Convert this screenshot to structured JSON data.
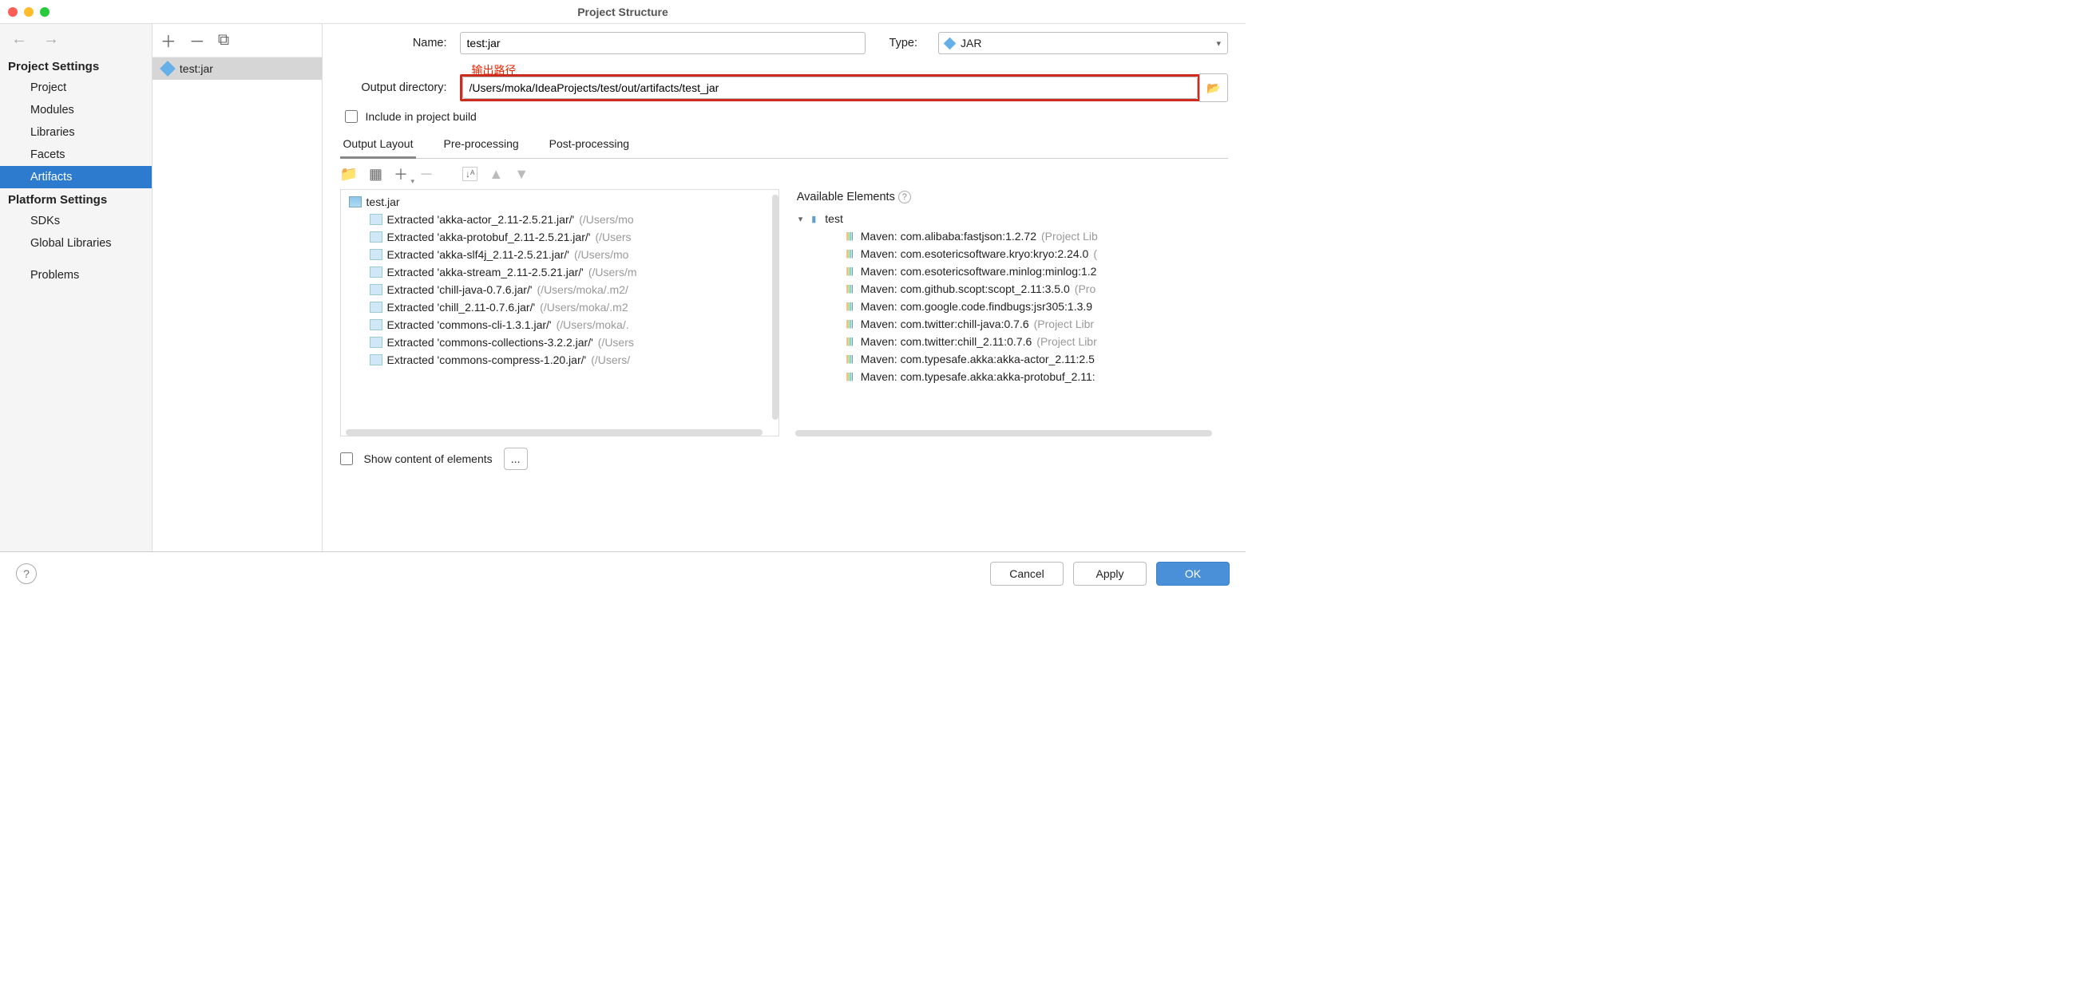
{
  "window": {
    "title": "Project Structure"
  },
  "sidebar": {
    "sections": [
      {
        "title": "Project Settings",
        "items": [
          "Project",
          "Modules",
          "Libraries",
          "Facets",
          "Artifacts"
        ]
      },
      {
        "title": "Platform Settings",
        "items": [
          "SDKs",
          "Global Libraries"
        ]
      }
    ],
    "standalone": [
      "Problems"
    ],
    "active": "Artifacts"
  },
  "listpane": {
    "item": "test:jar"
  },
  "form": {
    "name_label": "Name:",
    "name_value": "test:jar",
    "type_label": "Type:",
    "type_value": "JAR",
    "annotation": "输出路径",
    "outdir_label": "Output directory:",
    "outdir_value": "/Users/moka/IdeaProjects/test/out/artifacts/test_jar",
    "include_label": "Include in project build"
  },
  "tabs": [
    "Output Layout",
    "Pre-processing",
    "Post-processing"
  ],
  "active_tab": "Output Layout",
  "output_tree": {
    "root": "test.jar",
    "children": [
      {
        "label": "Extracted 'akka-actor_2.11-2.5.21.jar/'",
        "suffix": "(/Users/mo"
      },
      {
        "label": "Extracted 'akka-protobuf_2.11-2.5.21.jar/'",
        "suffix": "(/Users"
      },
      {
        "label": "Extracted 'akka-slf4j_2.11-2.5.21.jar/'",
        "suffix": "(/Users/mo"
      },
      {
        "label": "Extracted 'akka-stream_2.11-2.5.21.jar/'",
        "suffix": "(/Users/m"
      },
      {
        "label": "Extracted 'chill-java-0.7.6.jar/'",
        "suffix": "(/Users/moka/.m2/"
      },
      {
        "label": "Extracted 'chill_2.11-0.7.6.jar/'",
        "suffix": "(/Users/moka/.m2"
      },
      {
        "label": "Extracted 'commons-cli-1.3.1.jar/'",
        "suffix": "(/Users/moka/."
      },
      {
        "label": "Extracted 'commons-collections-3.2.2.jar/'",
        "suffix": "(/Users"
      },
      {
        "label": "Extracted 'commons-compress-1.20.jar/'",
        "suffix": "(/Users/"
      }
    ]
  },
  "available": {
    "heading": "Available Elements",
    "root": "test",
    "children": [
      {
        "label": "Maven: com.alibaba:fastjson:1.2.72",
        "suffix": "(Project Lib"
      },
      {
        "label": "Maven: com.esotericsoftware.kryo:kryo:2.24.0",
        "suffix": "("
      },
      {
        "label": "Maven: com.esotericsoftware.minlog:minlog:1.2",
        "suffix": ""
      },
      {
        "label": "Maven: com.github.scopt:scopt_2.11:3.5.0",
        "suffix": "(Pro"
      },
      {
        "label": "Maven: com.google.code.findbugs:jsr305:1.3.9",
        "suffix": ""
      },
      {
        "label": "Maven: com.twitter:chill-java:0.7.6",
        "suffix": "(Project Libr"
      },
      {
        "label": "Maven: com.twitter:chill_2.11:0.7.6",
        "suffix": "(Project Libr"
      },
      {
        "label": "Maven: com.typesafe.akka:akka-actor_2.11:2.5",
        "suffix": ""
      },
      {
        "label": "Maven: com.typesafe.akka:akka-protobuf_2.11:",
        "suffix": ""
      }
    ]
  },
  "footer2": {
    "show_content": "Show content of elements",
    "more": "..."
  },
  "buttons": {
    "cancel": "Cancel",
    "apply": "Apply",
    "ok": "OK"
  }
}
